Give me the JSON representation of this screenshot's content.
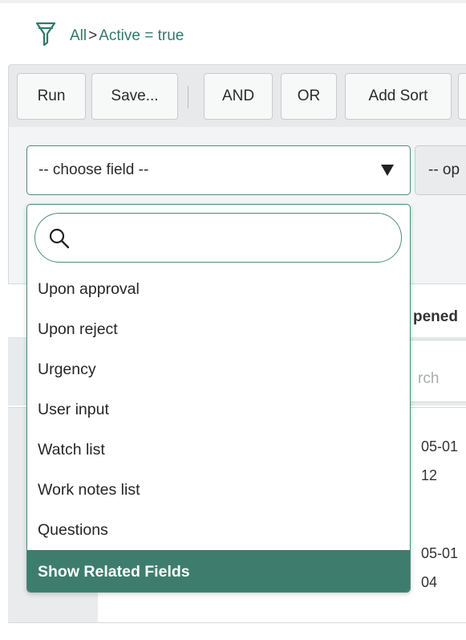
{
  "breadcrumb": {
    "root": "All",
    "separator": ">",
    "condition": "Active = true"
  },
  "toolbar": {
    "run": "Run",
    "save": "Save...",
    "and": "AND",
    "or": "OR",
    "add_sort": "Add Sort"
  },
  "condition": {
    "field_value": "-- choose field --",
    "operator_value": "-- op"
  },
  "background": {
    "column_header": "pened",
    "search_placeholder": "rch",
    "row1_line1": "05-01",
    "row1_line2": "12",
    "row2_line1": "05-01",
    "row2_line2": "04"
  },
  "dropdown": {
    "search_value": "",
    "items": [
      "Upon approval",
      "Upon reject",
      "Urgency",
      "User input",
      "Watch list",
      "Work notes list",
      "Questions",
      "Show Related Fields"
    ],
    "selected_item": "Show Related Fields"
  },
  "colors": {
    "accent": "#3e7d6d",
    "breadcrumb_link": "#2f7a6a",
    "border_focus": "#4d8b7c"
  }
}
